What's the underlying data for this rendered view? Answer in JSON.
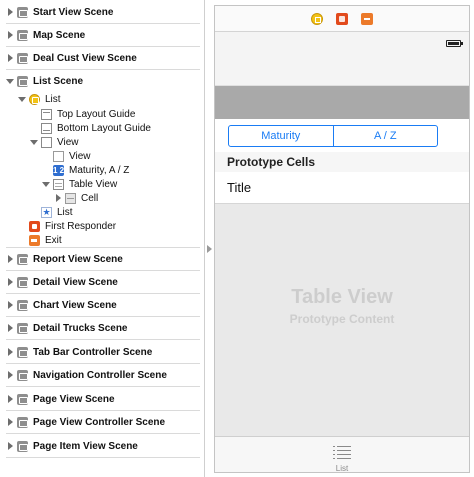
{
  "outline": {
    "scenes_top": [
      {
        "label": "Start View Scene"
      },
      {
        "label": "Map Scene"
      },
      {
        "label": "Deal Cust View Scene"
      },
      {
        "label": "List Scene"
      }
    ],
    "list_scene_children": [
      {
        "label": "List",
        "icon": "view-controller-icon"
      },
      {
        "label": "Top Layout Guide",
        "icon": "layout-guide-icon"
      },
      {
        "label": "Bottom Layout Guide",
        "icon": "layout-guide-icon"
      },
      {
        "label": "View",
        "icon": "view-icon"
      },
      {
        "label": "View",
        "icon": "view-icon"
      },
      {
        "label": "Maturity, A / Z",
        "icon": "segmented-control-icon"
      },
      {
        "label": "Table View",
        "icon": "table-view-icon"
      },
      {
        "label": "Cell",
        "icon": "table-cell-icon"
      },
      {
        "label": "List",
        "icon": "tab-bar-item-icon"
      },
      {
        "label": "First Responder",
        "icon": "first-responder-icon"
      },
      {
        "label": "Exit",
        "icon": "exit-icon"
      }
    ],
    "scenes_bottom": [
      {
        "label": "Report View Scene"
      },
      {
        "label": "Detail View Scene"
      },
      {
        "label": "Chart View Scene"
      },
      {
        "label": "Detail Trucks Scene"
      },
      {
        "label": "Tab Bar Controller Scene"
      },
      {
        "label": "Navigation Controller Scene"
      },
      {
        "label": "Page View Scene"
      },
      {
        "label": "Page View Controller Scene"
      },
      {
        "label": "Page Item View Scene"
      }
    ],
    "segmented_icon_glyph": "1 2"
  },
  "canvas": {
    "segmented": [
      "Maturity",
      "A / Z"
    ],
    "section_header": "Prototype Cells",
    "cell_title": "Title",
    "table_placeholder_title": "Table View",
    "table_placeholder_subtitle": "Prototype Content",
    "tab_label": "List",
    "accent_color": "#1a7cf4"
  }
}
